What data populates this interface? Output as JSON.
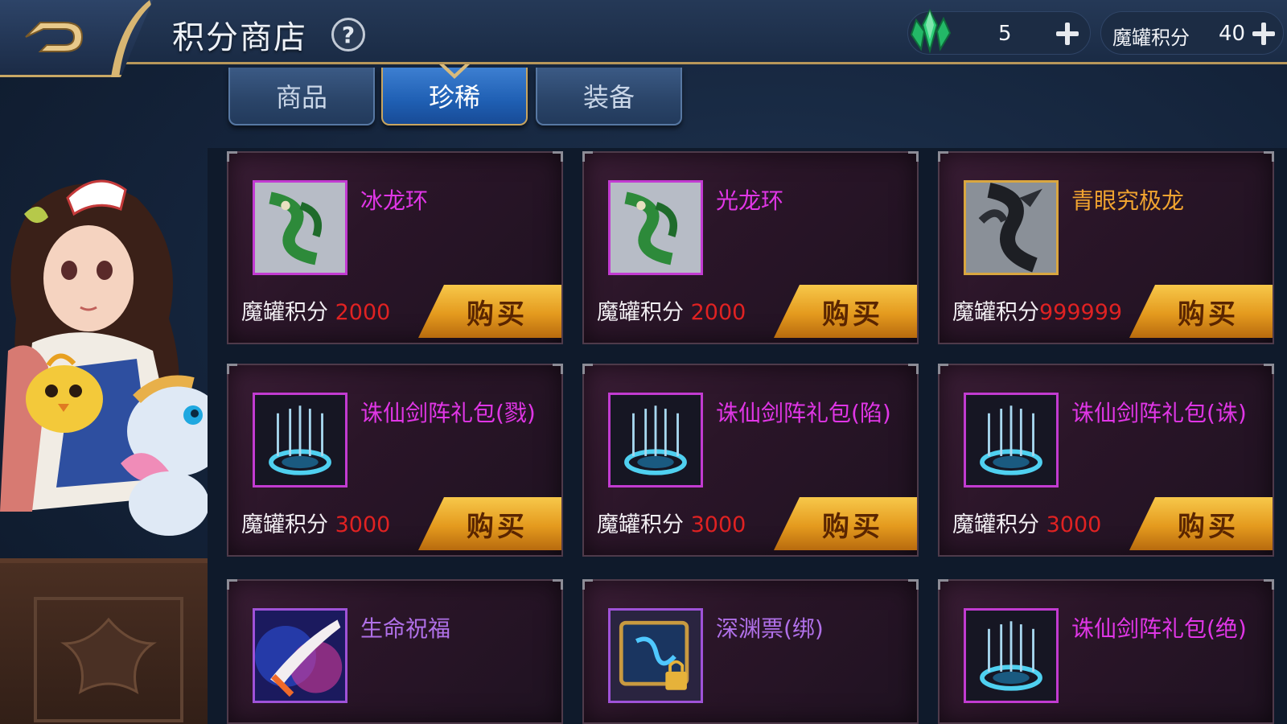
{
  "header": {
    "title": "积分商店",
    "help_symbol": "?"
  },
  "currencies": {
    "gem": {
      "icon": "crystal-icon",
      "value": "5"
    },
    "points": {
      "label": "魔罐积分",
      "value": "40"
    }
  },
  "tabs": [
    {
      "label": "商品",
      "active": false
    },
    {
      "label": "珍稀",
      "active": true
    },
    {
      "label": "装备",
      "active": false
    }
  ],
  "items": [
    {
      "name": "冰龙环",
      "name_color": "#e036e6",
      "icon": "green-dragon-icon",
      "price_label": "魔罐积分",
      "price": "2000",
      "buy_label": "购买"
    },
    {
      "name": "光龙环",
      "name_color": "#e036e6",
      "icon": "green-dragon-icon",
      "price_label": "魔罐积分",
      "price": "2000",
      "buy_label": "购买"
    },
    {
      "name": "青眼究极龙",
      "name_color": "#f0a330",
      "icon": "black-dragon-icon",
      "price_label": "魔罐积分",
      "price": "999999",
      "buy_label": "购买"
    },
    {
      "name": "诛仙剑阵礼包(戮)",
      "name_color": "#e036e6",
      "icon": "sword-array-icon",
      "price_label": "魔罐积分",
      "price": "3000",
      "buy_label": "购买"
    },
    {
      "name": "诛仙剑阵礼包(陷)",
      "name_color": "#e036e6",
      "icon": "sword-array-icon",
      "price_label": "魔罐积分",
      "price": "3000",
      "buy_label": "购买"
    },
    {
      "name": "诛仙剑阵礼包(诛)",
      "name_color": "#e036e6",
      "icon": "sword-array-icon",
      "price_label": "魔罐积分",
      "price": "3000",
      "buy_label": "购买"
    },
    {
      "name": "生命祝福",
      "name_color": "#b070e8",
      "icon": "blessing-hand-icon"
    },
    {
      "name": "深渊票(绑)",
      "name_color": "#b070e8",
      "icon": "abyss-ticket-icon"
    },
    {
      "name": "诛仙剑阵礼包(绝)",
      "name_color": "#e036e6",
      "icon": "sword-array-icon"
    }
  ],
  "colors": {
    "price": "#e02222",
    "buy_button": "#e49a1e",
    "active_tab": "#1f5fb3",
    "gold_trim": "#c9a865"
  }
}
